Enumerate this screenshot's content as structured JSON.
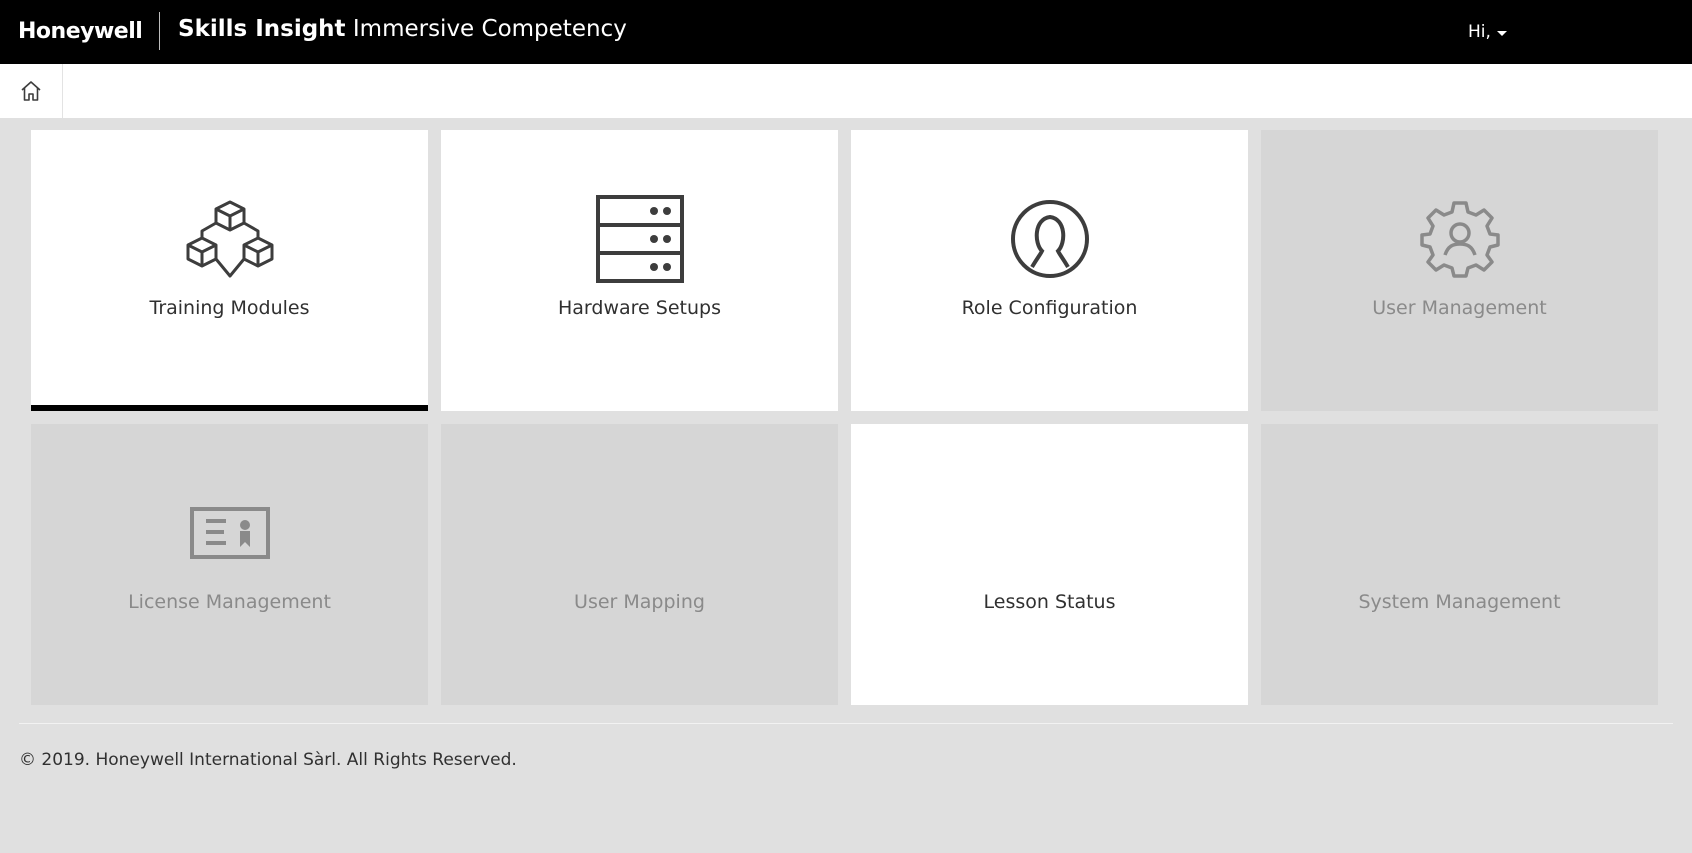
{
  "header": {
    "brand": "Honeywell",
    "title_strong": "Skills Insight",
    "title_rest": "Immersive Competency",
    "user_greeting": "Hi,"
  },
  "nav": {
    "home_icon": "home-icon"
  },
  "tiles": [
    {
      "label": "Training Modules",
      "icon": "cubes-icon",
      "enabled": true,
      "selected": true
    },
    {
      "label": "Hardware Setups",
      "icon": "server-rack-icon",
      "enabled": true,
      "selected": false
    },
    {
      "label": "Role Configuration",
      "icon": "person-circle-icon",
      "enabled": true,
      "selected": false
    },
    {
      "label": "User Management",
      "icon": "user-gear-icon",
      "enabled": false,
      "selected": false
    },
    {
      "label": "License Management",
      "icon": "license-card-icon",
      "enabled": false,
      "selected": false
    },
    {
      "label": "User Mapping",
      "icon": "",
      "enabled": false,
      "selected": false
    },
    {
      "label": "Lesson Status",
      "icon": "",
      "enabled": true,
      "selected": false
    },
    {
      "label": "System Management",
      "icon": "",
      "enabled": false,
      "selected": false
    }
  ],
  "footer": {
    "copyright": "© 2019. Honeywell International Sàrl. All Rights Reserved."
  },
  "colors": {
    "topbar": "#000000",
    "page_background": "#e0e0e0",
    "tile_enabled": "#ffffff",
    "tile_disabled": "#d6d6d6",
    "icon_enabled": "#3d3d3d",
    "icon_disabled": "#8a8a8a"
  }
}
